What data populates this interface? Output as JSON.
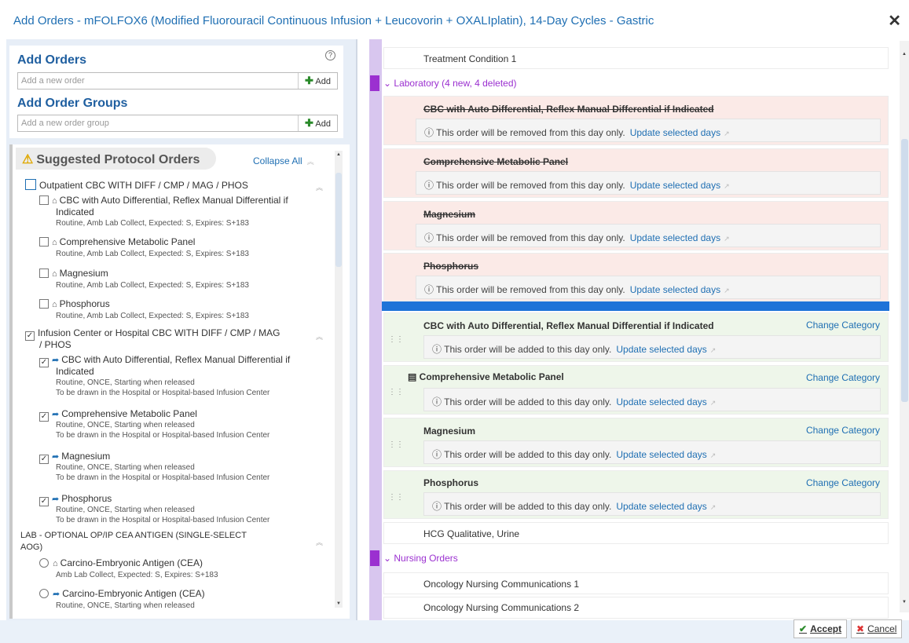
{
  "dialog": {
    "title": "Add Orders - mFOLFOX6 (Modified Fluorouracil Continuous Infusion + Leucovorin + OXALIplatin), 14-Day Cycles - Gastric",
    "close_glyph": "✕"
  },
  "add_orders": {
    "title": "Add Orders",
    "help_glyph": "?",
    "placeholder": "Add a new order",
    "add_label": "Add"
  },
  "add_order_groups": {
    "title": "Add Order Groups",
    "placeholder": "Add a new order group",
    "add_label": "Add"
  },
  "suggested": {
    "title": "Suggested Protocol Orders",
    "warn_glyph": "⚠",
    "collapse_all": "Collapse All",
    "groups": [
      {
        "label": "Outpatient CBC WITH DIFF / CMP / MAG / PHOS",
        "items": [
          {
            "name1": "CBC with Auto Differential, Reflex Manual Differential if",
            "name2": "Indicated",
            "detail": "Routine, Amb Lab Collect, Expected: S, Expires: S+183"
          },
          {
            "name1": "Comprehensive Metabolic Panel",
            "detail": "Routine, Amb Lab Collect, Expected: S, Expires: S+183"
          },
          {
            "name1": "Magnesium",
            "detail": "Routine, Amb Lab Collect, Expected: S, Expires: S+183"
          },
          {
            "name1": "Phosphorus",
            "detail": "Routine, Amb Lab Collect, Expected: S, Expires: S+183"
          }
        ]
      },
      {
        "label1": "Infusion Center or Hospital CBC WITH DIFF / CMP / MAG",
        "label2": "/ PHOS",
        "items": [
          {
            "name1": "CBC with Auto Differential, Reflex Manual Differential if",
            "name2": "Indicated",
            "detail": "Routine, ONCE, Starting when released",
            "detail2": "To be drawn in the Hospital or Hospital-based Infusion Center"
          },
          {
            "name1": "Comprehensive Metabolic Panel",
            "detail": "Routine, ONCE, Starting when released",
            "detail2": "To be drawn in the Hospital or Hospital-based Infusion Center"
          },
          {
            "name1": "Magnesium",
            "detail": "Routine, ONCE, Starting when released",
            "detail2": "To be drawn in the Hospital or Hospital-based Infusion Center"
          },
          {
            "name1": "Phosphorus",
            "detail": "Routine, ONCE, Starting when released",
            "detail2": "To be drawn in the Hospital or Hospital-based Infusion Center"
          }
        ]
      },
      {
        "label1": "LAB - OPTIONAL OP/IP CEA ANTIGEN (SINGLE-SELECT",
        "label2": "AOG)",
        "items": [
          {
            "name1": "Carcino-Embryonic Antigen (CEA)",
            "detail": "Amb Lab Collect, Expected: S, Expires: S+183"
          },
          {
            "name1": "Carcino-Embryonic Antigen (CEA)",
            "detail": "Routine, ONCE, Starting when released"
          }
        ]
      }
    ]
  },
  "right": {
    "treatment_condition": "Treatment Condition 1",
    "lab_category": "Laboratory (4 new, 4 deleted)",
    "removed": [
      "CBC with Auto Differential, Reflex Manual Differential if Indicated",
      "Comprehensive Metabolic Panel",
      "Magnesium",
      "Phosphorus"
    ],
    "removed_msg": "This order will be removed from this day only.",
    "added": [
      "CBC with Auto Differential, Reflex Manual Differential if Indicated",
      "Comprehensive Metabolic Panel",
      "Magnesium",
      "Phosphorus"
    ],
    "added_msg": "This order will be added to this day only.",
    "update_link": "Update selected days",
    "change_category": "Change Category",
    "hcg": "HCG Qualitative, Urine",
    "nursing_category": "Nursing Orders",
    "nursing": [
      "Oncology Nursing Communications 1",
      "Oncology Nursing Communications 2"
    ]
  },
  "footer": {
    "accept": "Accept",
    "cancel": "Cancel"
  }
}
